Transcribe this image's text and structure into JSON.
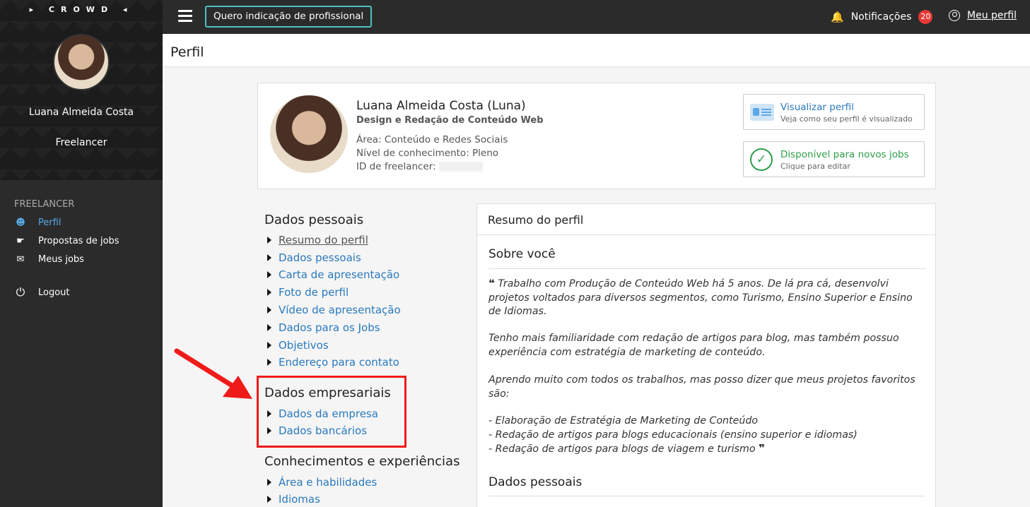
{
  "sidebar": {
    "logo": "▸ CROWD ◂",
    "name": "Luana Almeida Costa",
    "role": "Freelancer",
    "section": "FREELANCER",
    "items": [
      {
        "label": "Perfil",
        "icon": "person-icon"
      },
      {
        "label": "Propostas de jobs",
        "icon": "handshake-icon"
      },
      {
        "label": "Meus jobs",
        "icon": "chat-icon"
      },
      {
        "label": "Logout",
        "icon": "power-icon"
      }
    ]
  },
  "topbar": {
    "cta": "Quero indicação de profissional",
    "notifications_label": "Notificações",
    "notifications_count": "20",
    "profile_link": "Meu perfil"
  },
  "page": {
    "title": "Perfil"
  },
  "card": {
    "name": "Luana Almeida Costa (Luna)",
    "subtitle": "Design e Redação de Conteúdo Web",
    "area": "Área: Conteúdo e Redes Sociais",
    "level": "Nível de conhecimento: Pleno",
    "id_label": "ID de freelancer:",
    "view_title": "Visualizar perfil",
    "view_sub": "Veja como seu perfil é visualizado",
    "avail_title": "Disponível para novos jobs",
    "avail_sub": "Clique para editar",
    "colors": {
      "link": "#2a79bd",
      "available": "#2e9e4a"
    }
  },
  "nav": {
    "personal_title": "Dados pessoais",
    "personal_links": [
      "Resumo do perfil",
      "Dados pessoais",
      "Carta de apresentação",
      "Foto de perfil",
      "Vídeo de apresentação",
      "Dados para os Jobs",
      "Objetivos",
      "Endereço para contato"
    ],
    "business_title": "Dados empresariais",
    "business_links": [
      "Dados da empresa",
      "Dados bancários"
    ],
    "knowledge_title": "Conhecimentos e experiências",
    "knowledge_links": [
      "Área e habilidades",
      "Idiomas"
    ]
  },
  "summary": {
    "header": "Resumo do perfil",
    "about_title": "Sobre você",
    "p1": "Trabalho com Produção de Conteúdo Web há 5 anos. De lá pra cá, desenvolvi projetos voltados para diversos segmentos, como Turismo, Ensino Superior e Ensino de Idiomas.",
    "p2": "Tenho mais familiaridade com redação de artigos para blog, mas também possuo experiência com estratégia de marketing de conteúdo.",
    "p3": "Aprendo muito com todos os trabalhos, mas posso dizer que meus projetos favoritos são:",
    "list1": "- Elaboração de Estratégia de Marketing de Conteúdo",
    "list2": "- Redação de artigos para blogs educacionais (ensino superior e idiomas)",
    "list3": "- Redação de artigos para blogs de viagem e turismo",
    "personal_title": "Dados pessoais"
  }
}
